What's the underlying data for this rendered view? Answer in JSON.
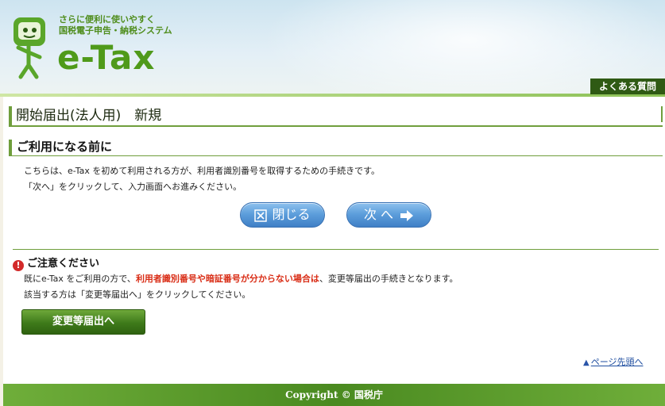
{
  "header": {
    "tagline_line1": "さらに便利に使いやすく",
    "tagline_line2": "国税電子申告・納税システム",
    "logo_text": "e-Tax",
    "faq_label": "よくある質問"
  },
  "page": {
    "title": "開始届出(法人用)　新規",
    "section_title": "ご利用になる前に",
    "intro_line1": "こちらは、e-Tax を初めて利用される方が、利用者識別番号を取得するための手続きです。",
    "intro_line2": "「次へ」をクリックして、入力画面へお進みください。"
  },
  "buttons": {
    "close_label": "閉じる",
    "next_label": "次 へ",
    "change_label": "変更等届出へ"
  },
  "notice": {
    "heading": "ご注意ください",
    "line1_prefix": "既にe-Tax をご利用の方で、",
    "line1_highlight": "利用者識別番号や暗証番号が分からない場合は",
    "line1_suffix": "、変更等届出の手続きとなります。",
    "line2": "該当する方は「変更等届出へ」をクリックしてください。"
  },
  "links": {
    "page_top": "ページ先頭へ"
  },
  "footer": {
    "copyright": "Copyright © 国税庁"
  },
  "colors": {
    "accent_green": "#6f9e3c",
    "button_blue": "#5e9fdc",
    "highlight_red": "#d92d16"
  }
}
